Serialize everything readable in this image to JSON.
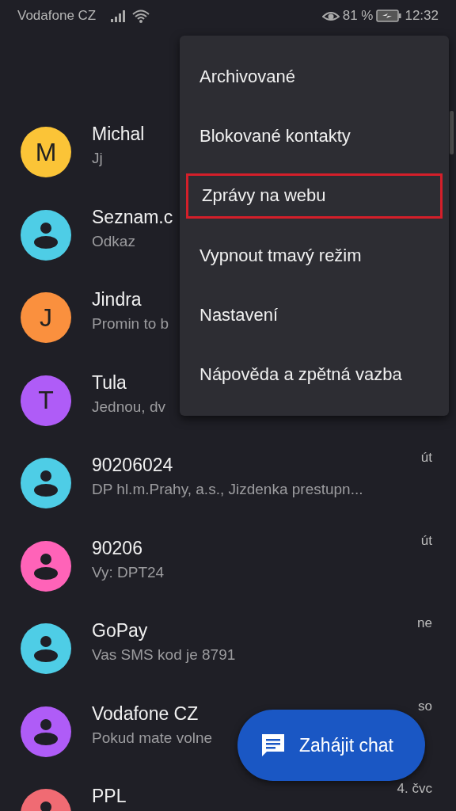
{
  "status_bar": {
    "carrier": "Vodafone CZ",
    "battery_percent": "81 %",
    "time": "12:32"
  },
  "conversations": [
    {
      "name": "Michal",
      "snippet": "Jj",
      "avatar": {
        "kind": "letter",
        "letter": "M",
        "color": "#fbc437"
      }
    },
    {
      "name": "Seznam.c",
      "snippet": "Odkaz",
      "avatar": {
        "kind": "person",
        "color": "#4ecde6"
      }
    },
    {
      "name": "Jindra",
      "snippet": "Promin to b",
      "avatar": {
        "kind": "letter",
        "letter": "J",
        "color": "#fa903e"
      }
    },
    {
      "name": "Tula",
      "snippet": "Jednou, dv",
      "avatar": {
        "kind": "letter",
        "letter": "T",
        "color": "#af5cf7"
      }
    },
    {
      "name": "90206024",
      "snippet": "DP hl.m.Prahy, a.s., Jizdenka prestupn...",
      "time": "út",
      "avatar": {
        "kind": "person",
        "color": "#4ecde6"
      }
    },
    {
      "name": "90206",
      "snippet": "Vy: DPT24",
      "time": "út",
      "avatar": {
        "kind": "person",
        "color": "#ff63b8"
      }
    },
    {
      "name": "GoPay",
      "snippet": "Vas SMS kod je 8791",
      "time": "ne",
      "avatar": {
        "kind": "person",
        "color": "#4ecde6"
      }
    },
    {
      "name": "Vodafone CZ",
      "snippet": "Pokud mate volne",
      "time": "so",
      "avatar": {
        "kind": "person",
        "color": "#af5cf7"
      }
    },
    {
      "name": "PPL",
      "time": "4. čvc",
      "avatar": {
        "kind": "person",
        "color": "#f06b73"
      }
    }
  ],
  "menu": {
    "items": [
      {
        "label": "Archivované",
        "highlighted": false
      },
      {
        "label": "Blokované kontakty",
        "highlighted": false
      },
      {
        "label": "Zprávy na webu",
        "highlighted": true
      },
      {
        "label": "Vypnout tmavý režim",
        "highlighted": false
      },
      {
        "label": "Nastavení",
        "highlighted": false
      },
      {
        "label": "Nápověda a zpětná vazba",
        "highlighted": false
      }
    ]
  },
  "fab": {
    "label": "Zahájit chat"
  }
}
